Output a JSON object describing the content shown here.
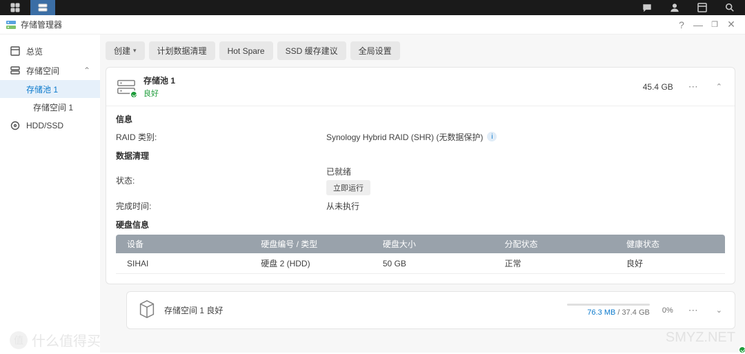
{
  "taskbar": {
    "icons_left": [
      "grid-icon",
      "storage-icon"
    ],
    "icons_right": [
      "chat-icon",
      "user-icon",
      "widget-icon",
      "search-icon"
    ]
  },
  "window": {
    "title": "存储管理器",
    "controls": {
      "help": "?",
      "min": "—",
      "max": "❐",
      "close": "✕"
    }
  },
  "sidebar": {
    "overview": "总览",
    "storage_space": "存储空间",
    "pool1": "存储池 1",
    "volume1": "存储空间 1",
    "hdd_ssd": "HDD/SSD"
  },
  "toolbar": {
    "create": "创建",
    "scrub": "计划数据清理",
    "hot_spare": "Hot Spare",
    "ssd_advice": "SSD 缓存建议",
    "global": "全局设置"
  },
  "pool": {
    "title": "存储池 1",
    "status": "良好",
    "size": "45.4 GB",
    "info_title": "信息",
    "raid_label": "RAID 类别:",
    "raid_value": "Synology Hybrid RAID (SHR) (无数据保护)",
    "scrub_title": "数据清理",
    "state_label": "状态:",
    "state_value": "已就绪",
    "run_now": "立即运行",
    "finish_label": "完成时间:",
    "finish_value": "从未执行",
    "disk_title": "硬盘信息",
    "table": {
      "headers": {
        "device": "设备",
        "slot": "硬盘编号 / 类型",
        "size": "硬盘大小",
        "alloc": "分配状态",
        "health": "健康状态"
      },
      "rows": [
        {
          "device": "SIHAI",
          "slot": "硬盘 2 (HDD)",
          "size": "50 GB",
          "alloc": "正常",
          "health": "良好"
        }
      ]
    }
  },
  "volume": {
    "title": "存储空间 1",
    "status": "良好",
    "used": "76.3 MB",
    "sep": " / ",
    "total": "37.4 GB",
    "pct": "0%"
  },
  "watermark": {
    "left": "值",
    "left2": "什么值得买",
    "right": "SMYZ.NET"
  }
}
